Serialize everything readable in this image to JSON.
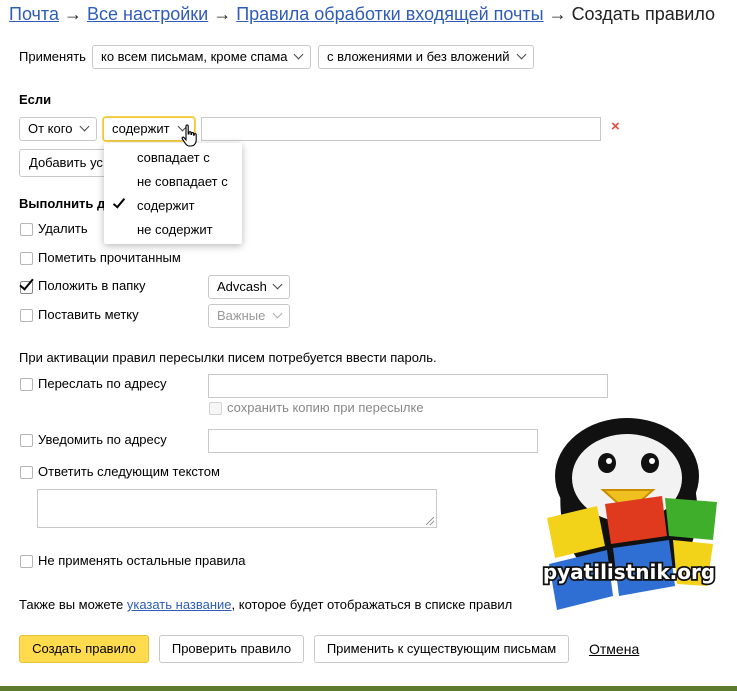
{
  "breadcrumbs": {
    "mail": "Почта",
    "all_settings": "Все настройки",
    "rules": "Правила обработки входящей почты",
    "current": "Создать правило",
    "separator": "→"
  },
  "apply": {
    "label": "Применять",
    "scope_select": "ко всем письмам, кроме спама",
    "attachments_select": "с вложениями и без вложений"
  },
  "condition": {
    "heading": "Если",
    "field_select": "От кого",
    "operator_select": "содержит",
    "value_input": "",
    "delete_symbol": "×",
    "add_button": "Добавить ус"
  },
  "operator_dropdown": {
    "items": [
      "совпадает с",
      "не совпадает с",
      "содержит",
      "не содержит"
    ],
    "selected_index": 2
  },
  "actions": {
    "heading": "Выполнить д",
    "delete": "Удалить",
    "mark_read": "Пометить прочитанным",
    "move_to_folder": "Положить в папку",
    "folder_select": "Advcash",
    "set_label": "Поставить метку",
    "label_select": "Важные"
  },
  "forwarding": {
    "note": "При активации правил пересылки писем потребуется ввести пароль.",
    "forward_to": "Переслать по адресу",
    "forward_value": "",
    "keep_copy": "сохранить копию при пересылке",
    "notify_to": "Уведомить по адресу",
    "notify_value": "",
    "reply_text": "Ответить следующим текстом",
    "reply_value": ""
  },
  "misc": {
    "stop_rules": "Не применять остальные правила",
    "name_hint_before": "Также вы можете ",
    "name_hint_link": "указать название",
    "name_hint_after": ", которое будет отображаться в списке правил"
  },
  "buttons": {
    "create": "Создать правило",
    "check": "Проверить правило",
    "apply_existing": "Применить к существующим письмам",
    "cancel": "Отмена"
  },
  "checkbox_states": {
    "delete": false,
    "mark_read": false,
    "move_to_folder": true,
    "set_label": false,
    "forward_to": false,
    "keep_copy": false,
    "notify_to": false,
    "reply_text": false,
    "stop_rules": false
  },
  "watermark": {
    "text": "pyatilistnik.org"
  },
  "colors": {
    "link": "#2e5cb8",
    "primary_button": "#ffdb4d",
    "focus_border": "#f3c43a",
    "delete_x": "#e74c3c"
  }
}
